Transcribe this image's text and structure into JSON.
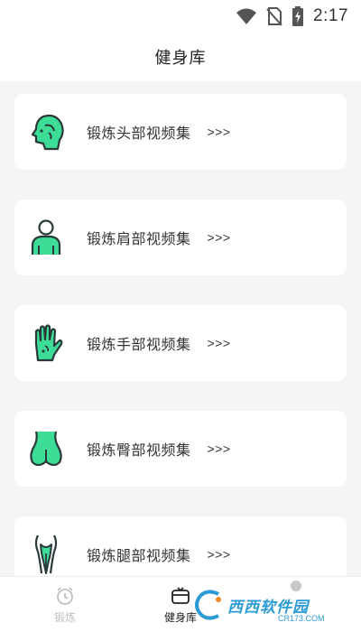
{
  "status_bar": {
    "time": "2:17"
  },
  "header": {
    "title": "健身库"
  },
  "list": {
    "items": [
      {
        "label": "锻炼头部视频集",
        "more": ">>>",
        "icon": "head-icon"
      },
      {
        "label": "锻炼肩部视频集",
        "more": ">>>",
        "icon": "shoulder-icon"
      },
      {
        "label": "锻炼手部视频集",
        "more": ">>>",
        "icon": "hand-icon"
      },
      {
        "label": "锻炼臀部视频集",
        "more": ">>>",
        "icon": "hip-icon"
      },
      {
        "label": "锻炼腿部视频集",
        "more": ">>>",
        "icon": "leg-icon"
      }
    ]
  },
  "bottom_nav": {
    "items": [
      {
        "label": "锻炼",
        "icon": "alarm-clock-icon"
      },
      {
        "label": "健身库",
        "icon": "library-box-icon",
        "active": true
      }
    ]
  },
  "watermark": {
    "text": "西西软件园",
    "sub": "CR173.COM"
  },
  "colors": {
    "accent": "#3ddc97",
    "stroke": "#2a3a3a",
    "background": "#f5f5f5"
  }
}
